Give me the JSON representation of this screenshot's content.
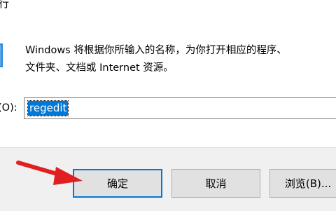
{
  "window": {
    "title_fragment": "行"
  },
  "description": {
    "line1": "Windows 将根据你所输入的名称，为你打开相应的程序、",
    "line2": "文件夹、文档或 Internet 资源。"
  },
  "open_field": {
    "label": "(O):",
    "value": "regedit"
  },
  "buttons": {
    "ok": "确定",
    "cancel": "取消",
    "browse": "浏览(B)..."
  },
  "colors": {
    "selection": "#0078d7",
    "footer_bg": "#f0f0f0",
    "button_bg": "#e1e1e1",
    "annotation_arrow": "#e02020"
  },
  "icons": {
    "run": "run-icon",
    "annotation": "red-arrow-annotation"
  }
}
